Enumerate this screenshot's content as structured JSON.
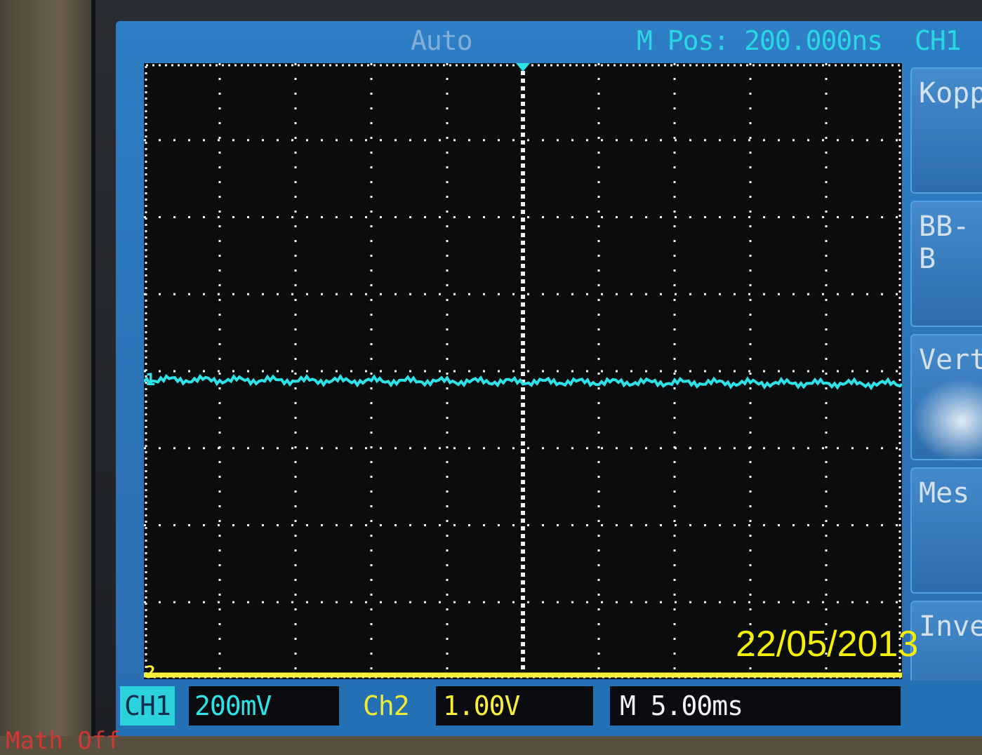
{
  "scope": {
    "trigger_mode": "Auto",
    "horizontal_position": "M Pos: 200.000ns",
    "menu_channel": "CH1"
  },
  "side_menu": {
    "items": [
      {
        "label": "Kopp"
      },
      {
        "label": "BB-B"
      },
      {
        "label": "Vert"
      },
      {
        "label": "Mes"
      },
      {
        "label": "Inve"
      }
    ]
  },
  "bottom_bar": {
    "ch1_label": "CH1",
    "ch1_scale": "200mV",
    "ch2_label": "Ch2",
    "ch2_scale": "1.00V",
    "timebase": "M 5.00ms",
    "math": "Math Off"
  },
  "photo": {
    "date_stamp": "22/05/2013"
  },
  "markers": {
    "ch1_marker": "1",
    "ch2_marker": "2"
  },
  "colors": {
    "ch1_trace": "#2ee3e8",
    "ch2_trace": "#f7ef3a",
    "screen": "#2b74b8",
    "grid": "#f2f2f2"
  }
}
